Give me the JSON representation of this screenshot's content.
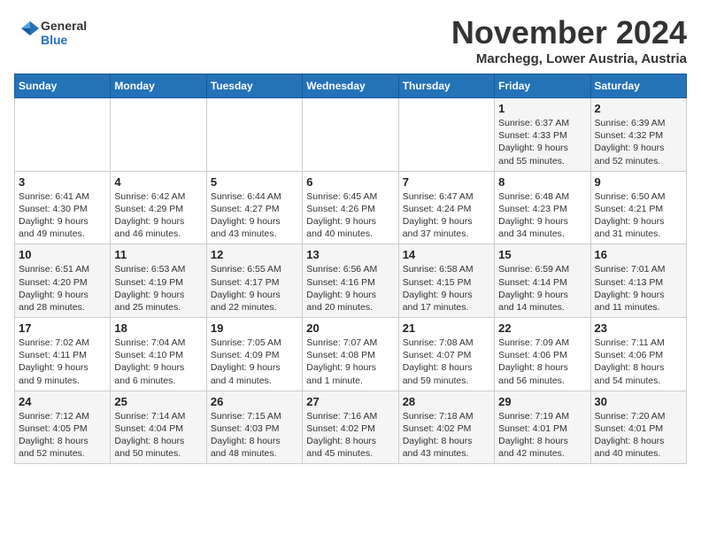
{
  "logo": {
    "line1": "General",
    "line2": "Blue"
  },
  "title": "November 2024",
  "location": "Marchegg, Lower Austria, Austria",
  "days_of_week": [
    "Sunday",
    "Monday",
    "Tuesday",
    "Wednesday",
    "Thursday",
    "Friday",
    "Saturday"
  ],
  "weeks": [
    [
      {
        "day": "",
        "info": ""
      },
      {
        "day": "",
        "info": ""
      },
      {
        "day": "",
        "info": ""
      },
      {
        "day": "",
        "info": ""
      },
      {
        "day": "",
        "info": ""
      },
      {
        "day": "1",
        "info": "Sunrise: 6:37 AM\nSunset: 4:33 PM\nDaylight: 9 hours\nand 55 minutes."
      },
      {
        "day": "2",
        "info": "Sunrise: 6:39 AM\nSunset: 4:32 PM\nDaylight: 9 hours\nand 52 minutes."
      }
    ],
    [
      {
        "day": "3",
        "info": "Sunrise: 6:41 AM\nSunset: 4:30 PM\nDaylight: 9 hours\nand 49 minutes."
      },
      {
        "day": "4",
        "info": "Sunrise: 6:42 AM\nSunset: 4:29 PM\nDaylight: 9 hours\nand 46 minutes."
      },
      {
        "day": "5",
        "info": "Sunrise: 6:44 AM\nSunset: 4:27 PM\nDaylight: 9 hours\nand 43 minutes."
      },
      {
        "day": "6",
        "info": "Sunrise: 6:45 AM\nSunset: 4:26 PM\nDaylight: 9 hours\nand 40 minutes."
      },
      {
        "day": "7",
        "info": "Sunrise: 6:47 AM\nSunset: 4:24 PM\nDaylight: 9 hours\nand 37 minutes."
      },
      {
        "day": "8",
        "info": "Sunrise: 6:48 AM\nSunset: 4:23 PM\nDaylight: 9 hours\nand 34 minutes."
      },
      {
        "day": "9",
        "info": "Sunrise: 6:50 AM\nSunset: 4:21 PM\nDaylight: 9 hours\nand 31 minutes."
      }
    ],
    [
      {
        "day": "10",
        "info": "Sunrise: 6:51 AM\nSunset: 4:20 PM\nDaylight: 9 hours\nand 28 minutes."
      },
      {
        "day": "11",
        "info": "Sunrise: 6:53 AM\nSunset: 4:19 PM\nDaylight: 9 hours\nand 25 minutes."
      },
      {
        "day": "12",
        "info": "Sunrise: 6:55 AM\nSunset: 4:17 PM\nDaylight: 9 hours\nand 22 minutes."
      },
      {
        "day": "13",
        "info": "Sunrise: 6:56 AM\nSunset: 4:16 PM\nDaylight: 9 hours\nand 20 minutes."
      },
      {
        "day": "14",
        "info": "Sunrise: 6:58 AM\nSunset: 4:15 PM\nDaylight: 9 hours\nand 17 minutes."
      },
      {
        "day": "15",
        "info": "Sunrise: 6:59 AM\nSunset: 4:14 PM\nDaylight: 9 hours\nand 14 minutes."
      },
      {
        "day": "16",
        "info": "Sunrise: 7:01 AM\nSunset: 4:13 PM\nDaylight: 9 hours\nand 11 minutes."
      }
    ],
    [
      {
        "day": "17",
        "info": "Sunrise: 7:02 AM\nSunset: 4:11 PM\nDaylight: 9 hours\nand 9 minutes."
      },
      {
        "day": "18",
        "info": "Sunrise: 7:04 AM\nSunset: 4:10 PM\nDaylight: 9 hours\nand 6 minutes."
      },
      {
        "day": "19",
        "info": "Sunrise: 7:05 AM\nSunset: 4:09 PM\nDaylight: 9 hours\nand 4 minutes."
      },
      {
        "day": "20",
        "info": "Sunrise: 7:07 AM\nSunset: 4:08 PM\nDaylight: 9 hours\nand 1 minute."
      },
      {
        "day": "21",
        "info": "Sunrise: 7:08 AM\nSunset: 4:07 PM\nDaylight: 8 hours\nand 59 minutes."
      },
      {
        "day": "22",
        "info": "Sunrise: 7:09 AM\nSunset: 4:06 PM\nDaylight: 8 hours\nand 56 minutes."
      },
      {
        "day": "23",
        "info": "Sunrise: 7:11 AM\nSunset: 4:06 PM\nDaylight: 8 hours\nand 54 minutes."
      }
    ],
    [
      {
        "day": "24",
        "info": "Sunrise: 7:12 AM\nSunset: 4:05 PM\nDaylight: 8 hours\nand 52 minutes."
      },
      {
        "day": "25",
        "info": "Sunrise: 7:14 AM\nSunset: 4:04 PM\nDaylight: 8 hours\nand 50 minutes."
      },
      {
        "day": "26",
        "info": "Sunrise: 7:15 AM\nSunset: 4:03 PM\nDaylight: 8 hours\nand 48 minutes."
      },
      {
        "day": "27",
        "info": "Sunrise: 7:16 AM\nSunset: 4:02 PM\nDaylight: 8 hours\nand 45 minutes."
      },
      {
        "day": "28",
        "info": "Sunrise: 7:18 AM\nSunset: 4:02 PM\nDaylight: 8 hours\nand 43 minutes."
      },
      {
        "day": "29",
        "info": "Sunrise: 7:19 AM\nSunset: 4:01 PM\nDaylight: 8 hours\nand 42 minutes."
      },
      {
        "day": "30",
        "info": "Sunrise: 7:20 AM\nSunset: 4:01 PM\nDaylight: 8 hours\nand 40 minutes."
      }
    ]
  ]
}
